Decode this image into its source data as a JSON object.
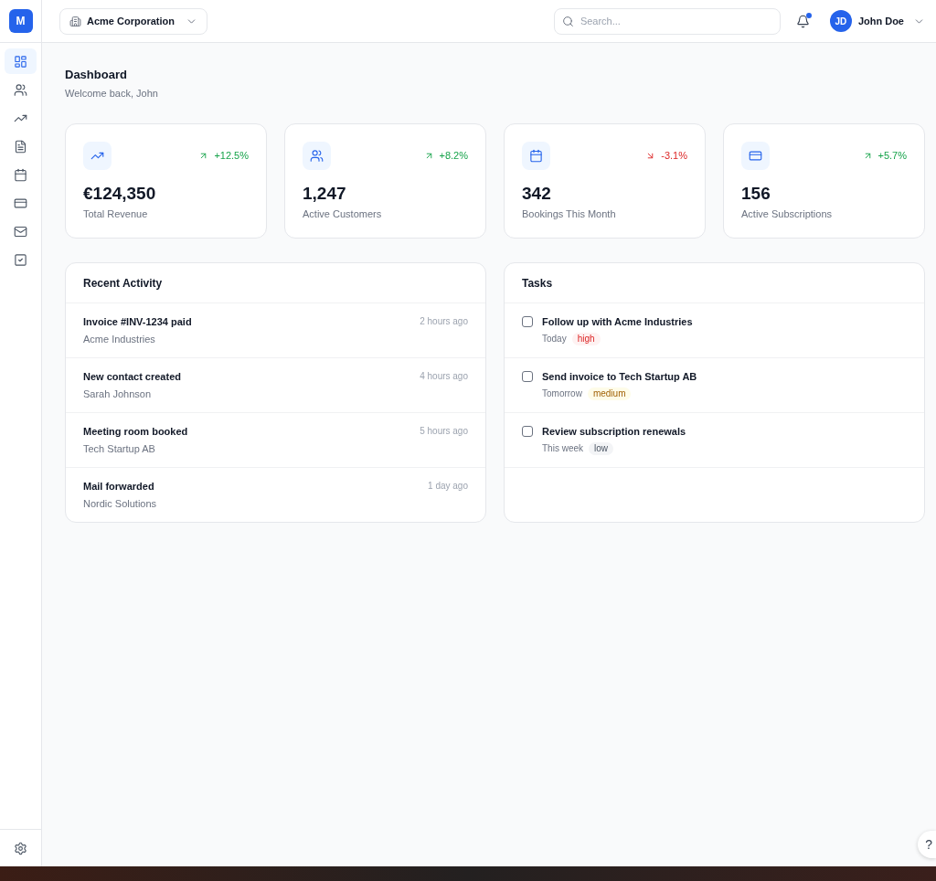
{
  "sidebar": {
    "logo": "M",
    "items": [
      {
        "selected": true
      },
      {
        "selected": false
      },
      {
        "selected": false
      },
      {
        "selected": false
      },
      {
        "selected": false
      },
      {
        "selected": false
      },
      {
        "selected": false
      },
      {
        "selected": false
      }
    ]
  },
  "topbar": {
    "organization": "Acme Corporation",
    "search": {
      "placeholder": "Search..."
    },
    "notifications": {
      "unread": true
    },
    "user": {
      "initials": "JD",
      "name": "John Doe"
    }
  },
  "page": {
    "title": "Dashboard",
    "subtitle": "Welcome back, John"
  },
  "stats": [
    {
      "value": "€124,350",
      "label": "Total Revenue",
      "change": "+12.5%",
      "kind": "up"
    },
    {
      "value": "1,247",
      "label": "Active Customers",
      "change": "+8.2%",
      "kind": "up"
    },
    {
      "value": "342",
      "label": "Bookings This Month",
      "change": "-3.1%",
      "kind": "down"
    },
    {
      "value": "156",
      "label": "Active Subscriptions",
      "change": "+5.7%",
      "kind": "up"
    }
  ],
  "recent_activity": {
    "title": "Recent Activity",
    "items": [
      {
        "title": "Invoice #INV-1234 paid",
        "subtitle": "Acme Industries",
        "time": "2 hours ago"
      },
      {
        "title": "New contact created",
        "subtitle": "Sarah Johnson",
        "time": "4 hours ago"
      },
      {
        "title": "Meeting room booked",
        "subtitle": "Tech Startup AB",
        "time": "5 hours ago"
      },
      {
        "title": "Mail forwarded",
        "subtitle": "Nordic Solutions",
        "time": "1 day ago"
      }
    ]
  },
  "tasks": {
    "title": "Tasks",
    "items": [
      {
        "title": "Follow up with Acme Industries",
        "checked": false,
        "due": "Today",
        "priority": {
          "text": "high",
          "kind": "high"
        }
      },
      {
        "title": "Send invoice to Tech Startup AB",
        "checked": false,
        "due": "Tomorrow",
        "priority": {
          "text": "medium",
          "kind": "medium"
        }
      },
      {
        "title": "Review subscription renewals",
        "checked": false,
        "due": "This week",
        "priority": {
          "text": "low",
          "kind": "low"
        }
      }
    ]
  },
  "help_button": "?"
}
